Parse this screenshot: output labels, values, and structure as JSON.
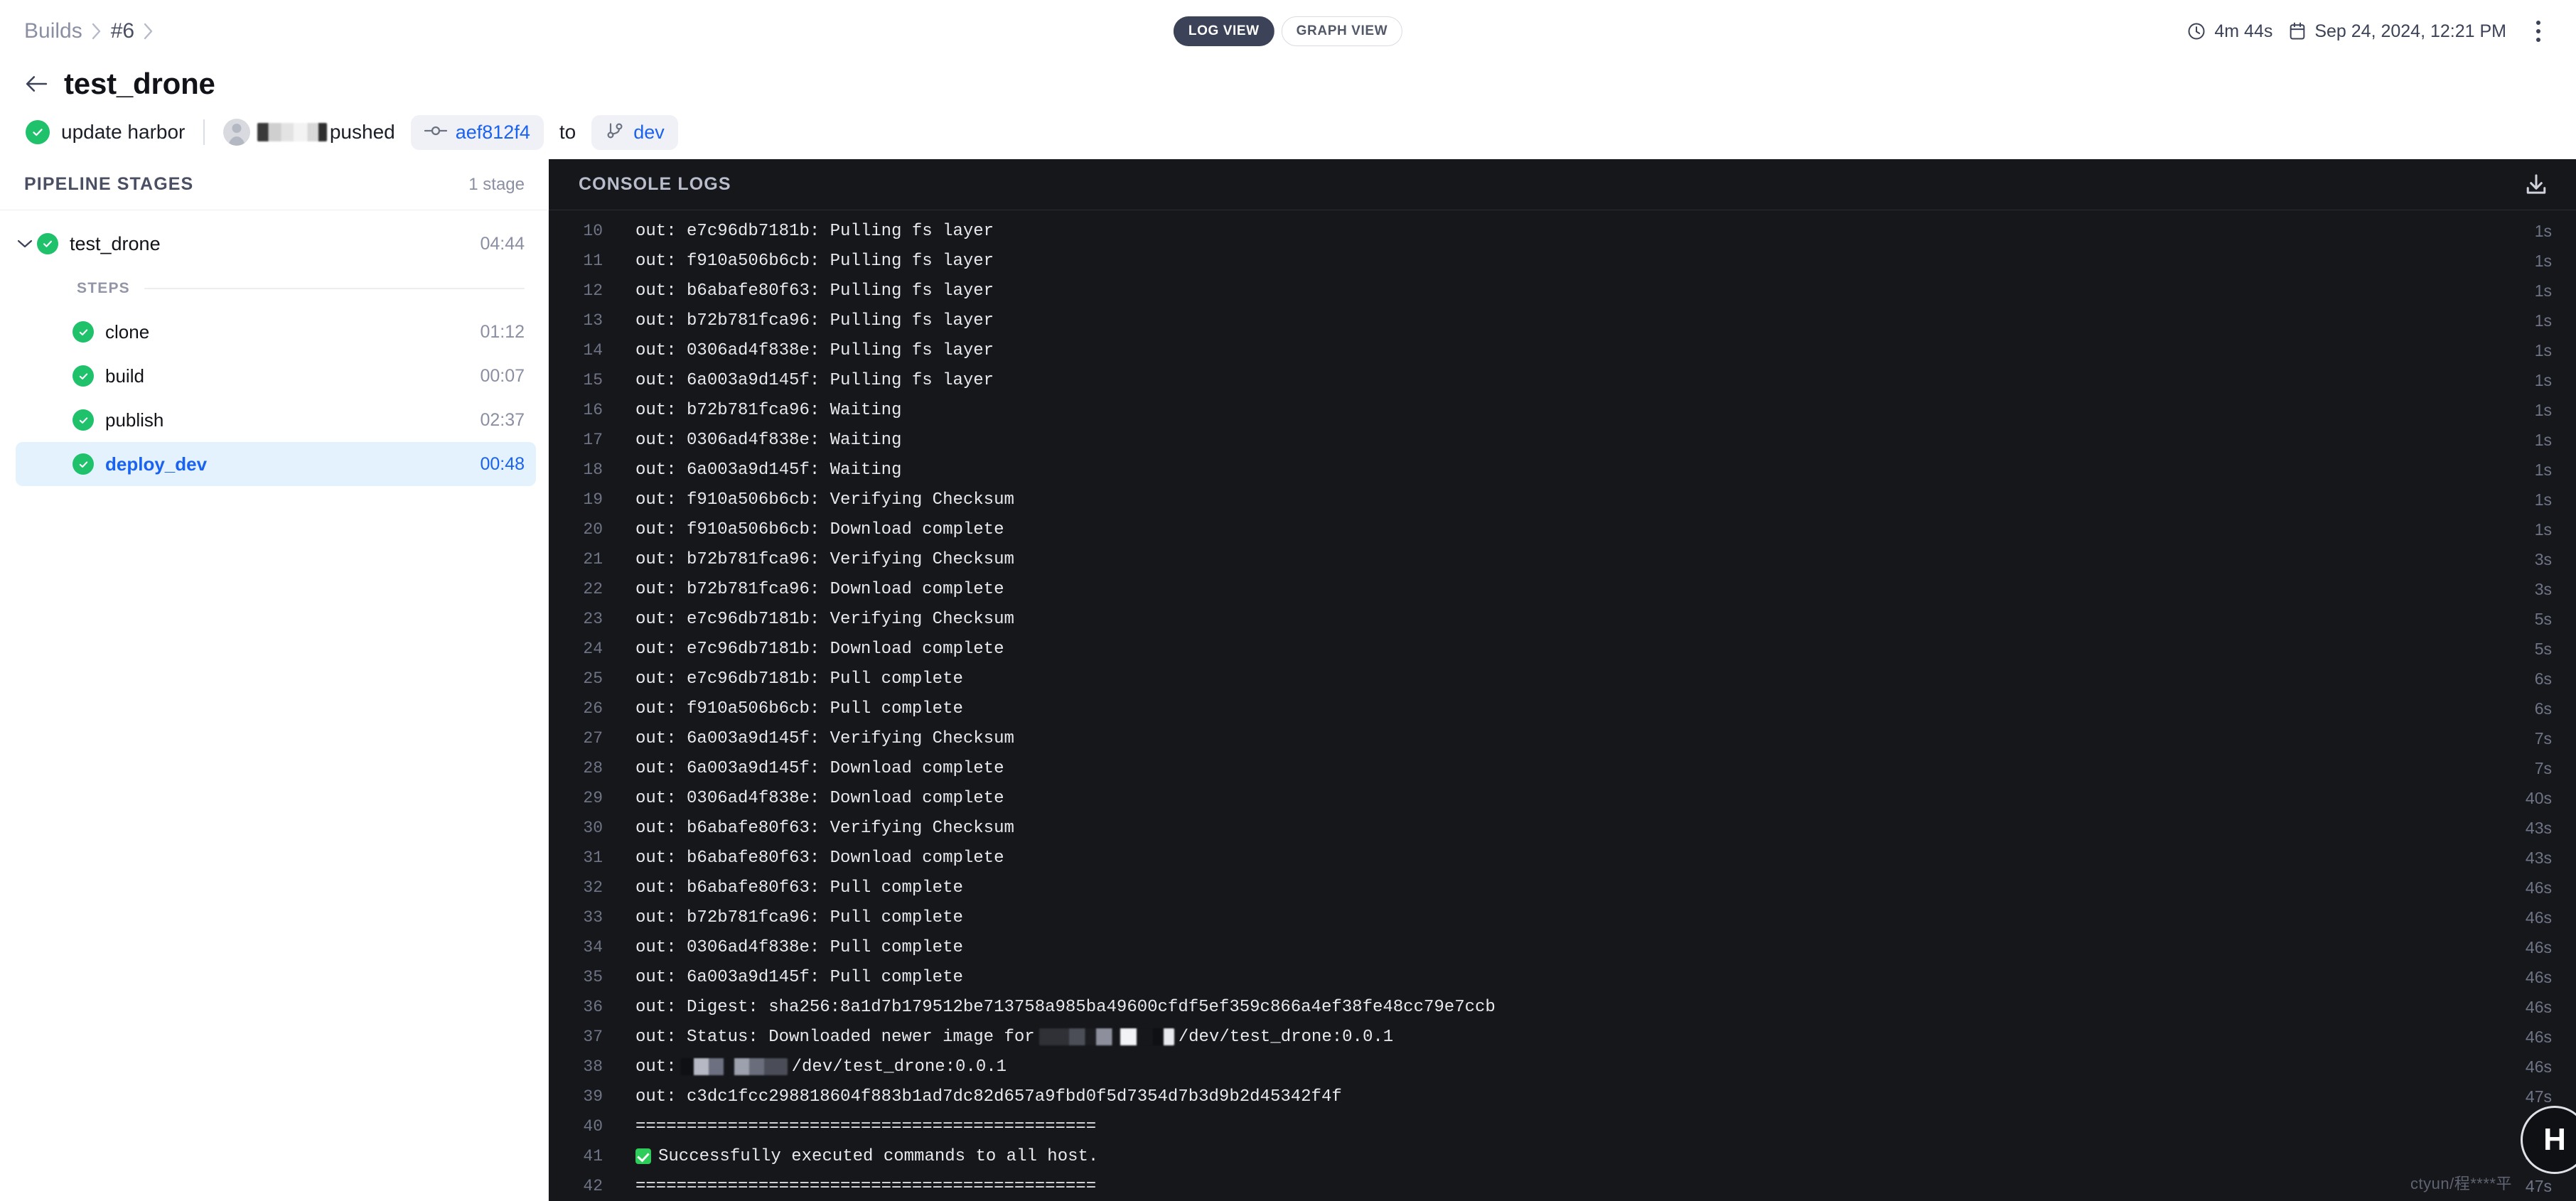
{
  "breadcrumb": {
    "root": "Builds",
    "build": "#6"
  },
  "view_toggle": {
    "log_label": "LOG VIEW",
    "graph_label": "GRAPH VIEW",
    "active": "LOG VIEW"
  },
  "top_right": {
    "duration": "4m 44s",
    "date": "Sep 24, 2024, 12:21 PM"
  },
  "header": {
    "title": "test_drone",
    "commit_message": "update harbor",
    "pushed_label": "pushed",
    "commit_sha": "aef812f4",
    "to_label": "to",
    "branch": "dev",
    "status_color": "#1fc16b",
    "link_color": "#1a62f0"
  },
  "sidebar": {
    "heading": "PIPELINE STAGES",
    "count_label": "1 stage",
    "stage": {
      "name": "test_drone",
      "time": "04:44"
    },
    "steps_label": "STEPS",
    "steps": [
      {
        "name": "clone",
        "time": "01:12",
        "active": false
      },
      {
        "name": "build",
        "time": "00:07",
        "active": false
      },
      {
        "name": "publish",
        "time": "02:37",
        "active": false
      },
      {
        "name": "deploy_dev",
        "time": "00:48",
        "active": true
      }
    ]
  },
  "console": {
    "heading": "CONSOLE LOGS",
    "download_icon": "download-icon",
    "lines": [
      {
        "n": "10",
        "text": "out: e7c96db7181b: Pulling fs layer",
        "ts": "1s"
      },
      {
        "n": "11",
        "text": "out: f910a506b6cb: Pulling fs layer",
        "ts": "1s"
      },
      {
        "n": "12",
        "text": "out: b6abafe80f63: Pulling fs layer",
        "ts": "1s"
      },
      {
        "n": "13",
        "text": "out: b72b781fca96: Pulling fs layer",
        "ts": "1s"
      },
      {
        "n": "14",
        "text": "out: 0306ad4f838e: Pulling fs layer",
        "ts": "1s"
      },
      {
        "n": "15",
        "text": "out: 6a003a9d145f: Pulling fs layer",
        "ts": "1s"
      },
      {
        "n": "16",
        "text": "out: b72b781fca96: Waiting",
        "ts": "1s"
      },
      {
        "n": "17",
        "text": "out: 0306ad4f838e: Waiting",
        "ts": "1s"
      },
      {
        "n": "18",
        "text": "out: 6a003a9d145f: Waiting",
        "ts": "1s"
      },
      {
        "n": "19",
        "text": "out: f910a506b6cb: Verifying Checksum",
        "ts": "1s"
      },
      {
        "n": "20",
        "text": "out: f910a506b6cb: Download complete",
        "ts": "1s"
      },
      {
        "n": "21",
        "text": "out: b72b781fca96: Verifying Checksum",
        "ts": "3s"
      },
      {
        "n": "22",
        "text": "out: b72b781fca96: Download complete",
        "ts": "3s"
      },
      {
        "n": "23",
        "text": "out: e7c96db7181b: Verifying Checksum",
        "ts": "5s"
      },
      {
        "n": "24",
        "text": "out: e7c96db7181b: Download complete",
        "ts": "5s"
      },
      {
        "n": "25",
        "text": "out: e7c96db7181b: Pull complete",
        "ts": "6s"
      },
      {
        "n": "26",
        "text": "out: f910a506b6cb: Pull complete",
        "ts": "6s"
      },
      {
        "n": "27",
        "text": "out: 6a003a9d145f: Verifying Checksum",
        "ts": "7s"
      },
      {
        "n": "28",
        "text": "out: 6a003a9d145f: Download complete",
        "ts": "7s"
      },
      {
        "n": "29",
        "text": "out: 0306ad4f838e: Download complete",
        "ts": "40s"
      },
      {
        "n": "30",
        "text": "out: b6abafe80f63: Verifying Checksum",
        "ts": "43s"
      },
      {
        "n": "31",
        "text": "out: b6abafe80f63: Download complete",
        "ts": "43s"
      },
      {
        "n": "32",
        "text": "out: b6abafe80f63: Pull complete",
        "ts": "46s"
      },
      {
        "n": "33",
        "text": "out: b72b781fca96: Pull complete",
        "ts": "46s"
      },
      {
        "n": "34",
        "text": "out: 0306ad4f838e: Pull complete",
        "ts": "46s"
      },
      {
        "n": "35",
        "text": "out: 6a003a9d145f: Pull complete",
        "ts": "46s"
      },
      {
        "n": "36",
        "text": "out: Digest: sha256:8a1d7b179512be713758a985ba49600cfdf5ef359c866a4ef38fe48cc79e7ccb",
        "ts": "46s"
      },
      {
        "n": "37",
        "kind": "redacted-status",
        "pre": "out: Status: Downloaded newer image for ",
        "post": "/dev/test_drone:0.0.1",
        "ts": "46s"
      },
      {
        "n": "38",
        "kind": "redacted-image",
        "pre": "out: ",
        "post": "/dev/test_drone:0.0.1",
        "ts": "46s"
      },
      {
        "n": "39",
        "text": "out: c3dc1fcc298818604f883b1ad7dc82d657a9fbd0f5d7354d7b3d9b2d45342f4f",
        "ts": "47s"
      },
      {
        "n": "40",
        "text": "=============================================",
        "ts": "47s"
      },
      {
        "n": "41",
        "kind": "success",
        "text": "Successfully executed commands to all host.",
        "ts": "47s"
      },
      {
        "n": "42",
        "text": "=============================================",
        "ts": "47s"
      }
    ]
  },
  "fab": {
    "label": "H"
  },
  "watermark": {
    "text": "ctyun/程****平"
  }
}
